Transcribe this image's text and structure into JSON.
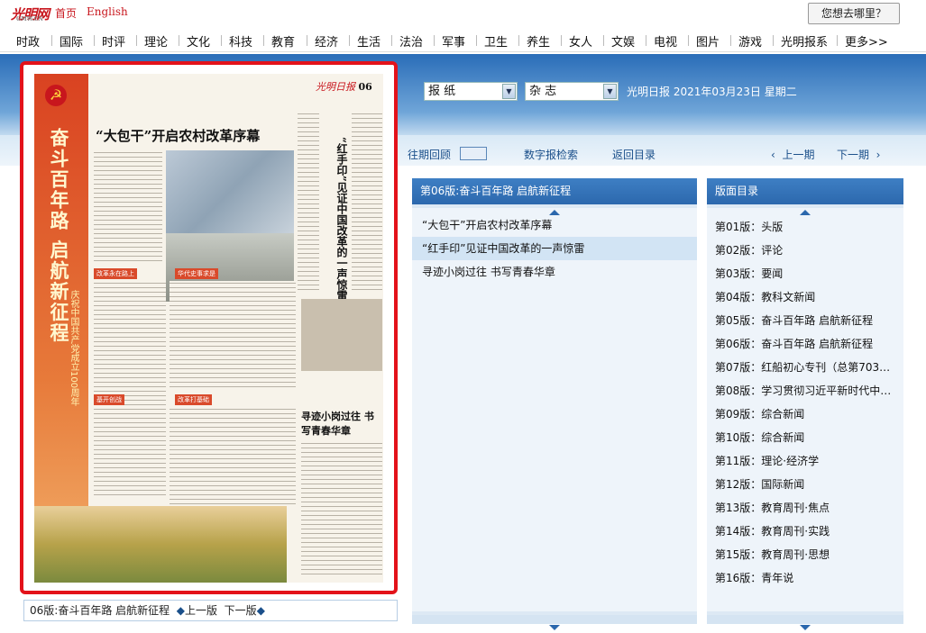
{
  "top": {
    "logo": "光明网",
    "logo_sub": "GMW.CN",
    "home": "首页",
    "english": "English",
    "search_button": "您想去哪里？"
  },
  "nav": [
    "时政",
    "国际",
    "时评",
    "理论",
    "文化",
    "科技",
    "教育",
    "经济",
    "生活",
    "法治",
    "军事",
    "卫生",
    "养生",
    "女人",
    "文娱",
    "电视",
    "图片",
    "游戏",
    "光明报系",
    "更多>>"
  ],
  "selectors": {
    "paper": "报 纸",
    "magazine": "杂 志"
  },
  "date_info": "光明日报 2021年03月23日 星期二",
  "subnav": {
    "past_review": "往期回顾",
    "digital_search": "数字报检索",
    "back_to_index": "返回目录",
    "prev_issue": "上一期",
    "next_issue": "下一期"
  },
  "newspaper": {
    "masthead": "光明日报",
    "page_no": "06",
    "sidebar_title": "奋斗百年路 启航新征程",
    "sidebar_sub": "庆祝中国共产党成立100周年",
    "headline": "“大包干”开启农村改革序幕",
    "col2_title": "“红手印”见证中国改革的一声惊雷",
    "col3_title": "寻迹小岗过往 书写青春华章",
    "tag1": "改革永在路上",
    "tag2": "华代史事求是",
    "tag3": "改革打基础",
    "tag4": "基开创战"
  },
  "page_bar": {
    "label": "06版:奋斗百年路 启航新征程",
    "prev": "上一版",
    "next": "下一版"
  },
  "articles_panel": {
    "title": "第06版:奋斗百年路 启航新征程",
    "items": [
      "“大包干”开启农村改革序幕",
      "“红手印”见证中国改革的一声惊雷",
      "寻迹小岗过往 书写青春华章"
    ]
  },
  "toc_panel": {
    "title": "版面目录",
    "items": [
      "第01版：头版",
      "第02版：评论",
      "第03版：要闻",
      "第04版：教科文新闻",
      "第05版：奋斗百年路 启航新征程",
      "第06版：奋斗百年路 启航新征程",
      "第07版：红船初心专刊（总第703…",
      "第08版：学习贯彻习近平新时代中…",
      "第09版：综合新闻",
      "第10版：综合新闻",
      "第11版：理论·经济学",
      "第12版：国际新闻",
      "第13版：教育周刊·焦点",
      "第14版：教育周刊·实践",
      "第15版：教育周刊·思想",
      "第16版：青年说"
    ]
  },
  "colors": {
    "brand_red": "#c8161d",
    "panel_blue": "#2c68ad",
    "highlight": "#d2e4f4"
  }
}
